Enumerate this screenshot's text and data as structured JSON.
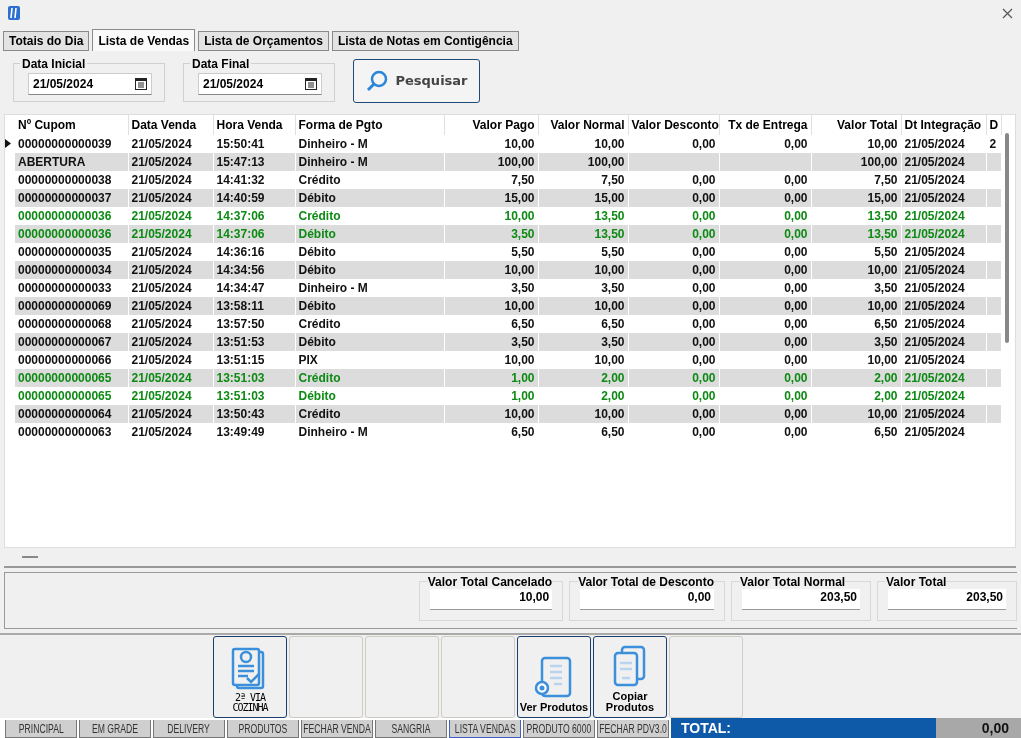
{
  "tabs": [
    {
      "label": "Totais do Dia",
      "selected": false
    },
    {
      "label": "Lista de Vendas",
      "selected": true
    },
    {
      "label": "Lista de Orçamentos",
      "selected": false
    },
    {
      "label": "Lista de Notas em Contigência",
      "selected": false
    }
  ],
  "filters": [
    {
      "label": "Data Inicial",
      "value": "21/05/2024"
    },
    {
      "label": "Data Final",
      "value": "21/05/2024"
    }
  ],
  "search_button": "Pesquisar",
  "table": {
    "columns": [
      "Nº Cupom",
      "Data Venda",
      "Hora Venda",
      "Forma de Pgto",
      "Valor Pago",
      "Valor Normal",
      "Valor Desconto",
      "Tx de Entrega",
      "Valor Total",
      "Dt Integração",
      "D"
    ],
    "rows": [
      {
        "selected": true,
        "highlighted": false,
        "cells": [
          "00000000000039",
          "21/05/2024",
          "15:50:41",
          "Dinheiro - M",
          "10,00",
          "10,00",
          "0,00",
          "0,00",
          "10,00",
          "21/05/2024",
          "2"
        ]
      },
      {
        "selected": false,
        "highlighted": false,
        "cells": [
          "ABERTURA",
          "21/05/2024",
          "15:47:13",
          "Dinheiro - M",
          "100,00",
          "100,00",
          "",
          "",
          "100,00",
          "21/05/2024",
          ""
        ]
      },
      {
        "selected": false,
        "highlighted": false,
        "cells": [
          "00000000000038",
          "21/05/2024",
          "14:41:32",
          "Crédito",
          "7,50",
          "7,50",
          "0,00",
          "0,00",
          "7,50",
          "21/05/2024",
          ""
        ]
      },
      {
        "selected": false,
        "highlighted": false,
        "cells": [
          "00000000000037",
          "21/05/2024",
          "14:40:59",
          "Débito",
          "15,00",
          "15,00",
          "0,00",
          "0,00",
          "15,00",
          "21/05/2024",
          ""
        ]
      },
      {
        "selected": false,
        "highlighted": true,
        "cells": [
          "00000000000036",
          "21/05/2024",
          "14:37:06",
          "Crédito",
          "10,00",
          "13,50",
          "0,00",
          "0,00",
          "13,50",
          "21/05/2024",
          ""
        ]
      },
      {
        "selected": false,
        "highlighted": true,
        "cells": [
          "00000000000036",
          "21/05/2024",
          "14:37:06",
          "Débito",
          "3,50",
          "13,50",
          "0,00",
          "0,00",
          "13,50",
          "21/05/2024",
          ""
        ]
      },
      {
        "selected": false,
        "highlighted": false,
        "cells": [
          "00000000000035",
          "21/05/2024",
          "14:36:16",
          "Débito",
          "5,50",
          "5,50",
          "0,00",
          "0,00",
          "5,50",
          "21/05/2024",
          ""
        ]
      },
      {
        "selected": false,
        "highlighted": false,
        "cells": [
          "00000000000034",
          "21/05/2024",
          "14:34:56",
          "Débito",
          "10,00",
          "10,00",
          "0,00",
          "0,00",
          "10,00",
          "21/05/2024",
          ""
        ]
      },
      {
        "selected": false,
        "highlighted": false,
        "cells": [
          "00000000000033",
          "21/05/2024",
          "14:34:47",
          "Dinheiro - M",
          "3,50",
          "3,50",
          "0,00",
          "0,00",
          "3,50",
          "21/05/2024",
          ""
        ]
      },
      {
        "selected": false,
        "highlighted": false,
        "cells": [
          "00000000000069",
          "21/05/2024",
          "13:58:11",
          "Débito",
          "10,00",
          "10,00",
          "0,00",
          "0,00",
          "10,00",
          "21/05/2024",
          ""
        ]
      },
      {
        "selected": false,
        "highlighted": false,
        "cells": [
          "00000000000068",
          "21/05/2024",
          "13:57:50",
          "Crédito",
          "6,50",
          "6,50",
          "0,00",
          "0,00",
          "6,50",
          "21/05/2024",
          ""
        ]
      },
      {
        "selected": false,
        "highlighted": false,
        "cells": [
          "00000000000067",
          "21/05/2024",
          "13:51:53",
          "Débito",
          "3,50",
          "3,50",
          "0,00",
          "0,00",
          "3,50",
          "21/05/2024",
          ""
        ]
      },
      {
        "selected": false,
        "highlighted": false,
        "cells": [
          "00000000000066",
          "21/05/2024",
          "13:51:15",
          "PIX",
          "10,00",
          "10,00",
          "0,00",
          "0,00",
          "10,00",
          "21/05/2024",
          ""
        ]
      },
      {
        "selected": false,
        "highlighted": true,
        "cells": [
          "00000000000065",
          "21/05/2024",
          "13:51:03",
          "Crédito",
          "1,00",
          "2,00",
          "0,00",
          "0,00",
          "2,00",
          "21/05/2024",
          ""
        ]
      },
      {
        "selected": false,
        "highlighted": true,
        "cells": [
          "00000000000065",
          "21/05/2024",
          "13:51:03",
          "Débito",
          "1,00",
          "2,00",
          "0,00",
          "0,00",
          "2,00",
          "21/05/2024",
          ""
        ]
      },
      {
        "selected": false,
        "highlighted": false,
        "cells": [
          "00000000000064",
          "21/05/2024",
          "13:50:43",
          "Crédito",
          "10,00",
          "10,00",
          "0,00",
          "0,00",
          "10,00",
          "21/05/2024",
          ""
        ]
      },
      {
        "selected": false,
        "highlighted": false,
        "cells": [
          "00000000000063",
          "21/05/2024",
          "13:49:49",
          "Dinheiro - M",
          "6,50",
          "6,50",
          "0,00",
          "0,00",
          "6,50",
          "21/05/2024",
          ""
        ]
      }
    ]
  },
  "totals": [
    {
      "label": "Valor Total Cancelado",
      "value": "10,00"
    },
    {
      "label": "Valor Total de Desconto",
      "value": "0,00"
    },
    {
      "label": "Valor Total Normal",
      "value": "203,50"
    },
    {
      "label": "Valor Total",
      "value": "203,50"
    }
  ],
  "actions": [
    {
      "kind": "receipt",
      "label": "2ª VIA COZINHA"
    },
    {
      "kind": "blank"
    },
    {
      "kind": "blank"
    },
    {
      "kind": "blank"
    },
    {
      "kind": "view",
      "label": "Ver Produtos"
    },
    {
      "kind": "copy",
      "label": "Copiar Produtos"
    },
    {
      "kind": "blank"
    }
  ],
  "taskbar": [
    {
      "label": "PRINCIPAL",
      "selected": false
    },
    {
      "label": "EM GRADE",
      "selected": false
    },
    {
      "label": "DELIVERY",
      "selected": false
    },
    {
      "label": "PRODUTOS",
      "selected": false
    },
    {
      "label": "FECHAR VENDA",
      "selected": false
    },
    {
      "label": "SANGRIA",
      "selected": false
    },
    {
      "label": "LISTA VENDAS",
      "selected": true
    },
    {
      "label": "PRODUTO 6000",
      "selected": false
    },
    {
      "label": "FECHAR PDV3.0",
      "selected": false
    }
  ],
  "total_panel": {
    "label": "TOTAL:",
    "value": "0,00"
  }
}
